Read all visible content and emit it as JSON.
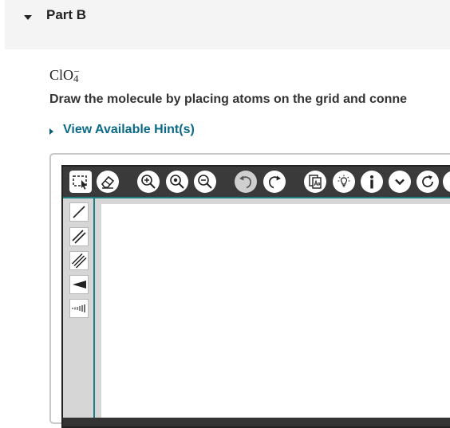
{
  "part": {
    "title": "Part B"
  },
  "question": {
    "formula_base": "ClO",
    "formula_sub": "4",
    "formula_sup": "−",
    "instruction": "Draw the molecule by placing atoms on the grid and conne"
  },
  "hint": {
    "label": "View Available Hint(s)"
  },
  "toolbar": {
    "tools": [
      {
        "name": "select-tool",
        "icon": "marquee-select-icon"
      },
      {
        "name": "erase-tool",
        "icon": "eraser-icon"
      },
      {
        "name": "zoom-in-tool",
        "icon": "zoom-in-icon"
      },
      {
        "name": "zoom-fit-tool",
        "icon": "zoom-fit-icon"
      },
      {
        "name": "zoom-out-tool",
        "icon": "zoom-out-icon"
      },
      {
        "name": "undo-tool",
        "icon": "undo-icon"
      },
      {
        "name": "redo-tool",
        "icon": "redo-icon"
      },
      {
        "name": "templates-tool",
        "icon": "template-icon"
      },
      {
        "name": "hint-bulb-tool",
        "icon": "lightbulb-icon"
      },
      {
        "name": "info-tool",
        "icon": "info-icon"
      },
      {
        "name": "more-tool",
        "icon": "chevron-down-icon"
      },
      {
        "name": "reset-tool",
        "icon": "reset-icon"
      }
    ]
  },
  "bond_tools": [
    {
      "name": "single-bond",
      "icon": "single-bond-icon"
    },
    {
      "name": "double-bond",
      "icon": "double-bond-icon"
    },
    {
      "name": "triple-bond",
      "icon": "triple-bond-icon"
    },
    {
      "name": "wedge-bond",
      "icon": "wedge-bond-icon"
    },
    {
      "name": "hash-bond",
      "icon": "hash-bond-icon"
    }
  ]
}
